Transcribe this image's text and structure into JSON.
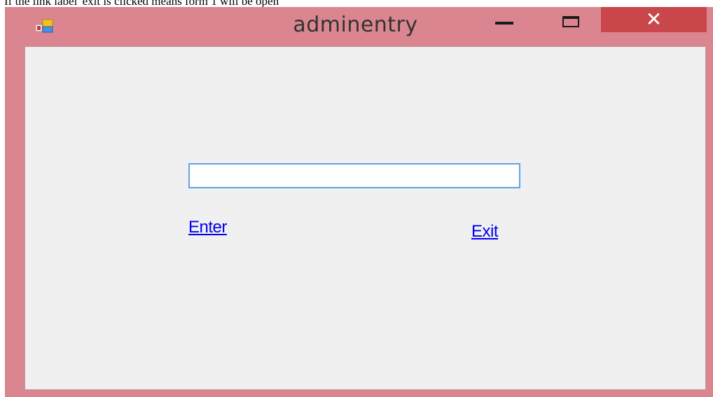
{
  "caption": "If the link label 'exit is clicked means form 1 will be open",
  "window": {
    "title": "adminentry",
    "controls": {
      "minimize_glyph": "",
      "maximize_glyph": "",
      "close_glyph": "✕"
    },
    "icon": "app-form-icon"
  },
  "form": {
    "textbox_value": "",
    "enter_link": "Enter",
    "exit_link": "Exit"
  },
  "colors": {
    "frame": "#db8590",
    "close_button": "#c9474b",
    "client_bg": "#f0f0f0",
    "link": "#0000ee",
    "textbox_focus_border": "#5fa3e6"
  }
}
